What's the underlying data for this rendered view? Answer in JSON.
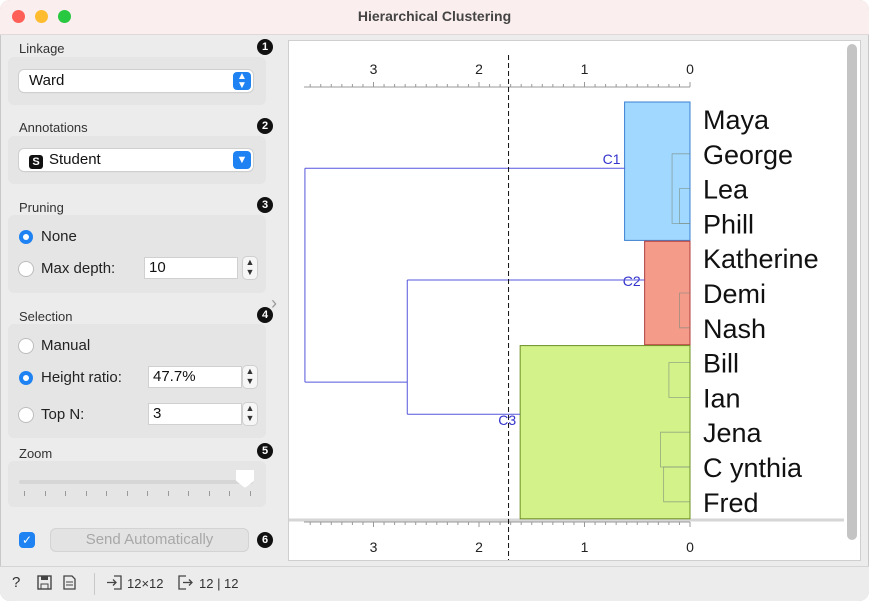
{
  "window": {
    "title": "Hierarchical Clustering"
  },
  "linkage": {
    "label": "Linkage",
    "badge": "1",
    "value": "Ward"
  },
  "annotations": {
    "label": "Annotations",
    "badge": "2",
    "value": "Student",
    "type_icon": "S"
  },
  "pruning": {
    "label": "Pruning",
    "badge": "3",
    "none_label": "None",
    "max_depth_label": "Max depth:",
    "max_depth_value": "10",
    "selected": "None"
  },
  "selection": {
    "label": "Selection",
    "badge": "4",
    "manual_label": "Manual",
    "height_ratio_label": "Height ratio:",
    "height_ratio_value": "47.7%",
    "top_n_label": "Top N:",
    "top_n_value": "3",
    "selected": "Height ratio"
  },
  "zoom": {
    "label": "Zoom",
    "badge": "5",
    "level_fraction": 0.96
  },
  "send": {
    "badge": "6",
    "auto_checked": true,
    "label": "Send Automatically"
  },
  "statusbar": {
    "input_summary": "12×12",
    "output_summary": "12 | 12"
  },
  "colors": {
    "cluster_c1": "#a0d8ff",
    "cluster_c2": "#f59b8a",
    "cluster_c3": "#d4f28a",
    "dendrogram_lines": "#5555dd",
    "accent": "#1e82f3"
  },
  "dendrogram": {
    "axis_ticks": [
      "3",
      "2",
      "1",
      "0"
    ],
    "cut_height": 1.72,
    "leaves": [
      "Maya",
      "George",
      "Lea",
      "Phill",
      "Katherine",
      "Demi",
      "Nash",
      "Bill",
      "Ian",
      "Jena",
      "C ynthia",
      "Fred"
    ],
    "clusters": [
      {
        "label": "C1",
        "members": [
          "Maya",
          "George",
          "Lea",
          "Phill"
        ]
      },
      {
        "label": "C2",
        "members": [
          "Katherine",
          "Demi",
          "Nash"
        ]
      },
      {
        "label": "C3",
        "members": [
          "Bill",
          "Ian",
          "Jena",
          "C ynthia",
          "Fred"
        ]
      }
    ]
  }
}
